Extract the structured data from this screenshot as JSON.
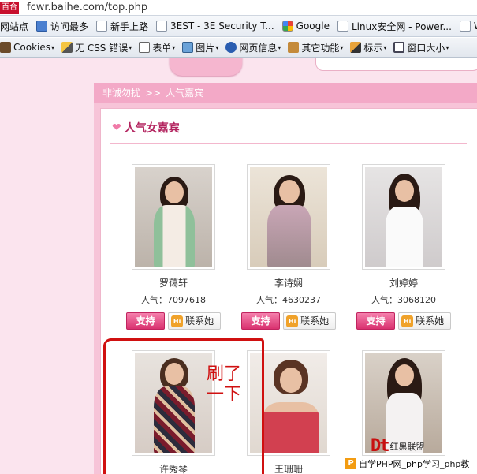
{
  "browser": {
    "site_tag": "百合",
    "url": "fcwr.baihe.com/top.php"
  },
  "bookmarks": [
    {
      "label": "网站点",
      "icon": "folder-icon"
    },
    {
      "label": "访问最多",
      "icon": "page-icon"
    },
    {
      "label": "新手上路",
      "icon": "page-icon"
    },
    {
      "label": "3EST - 3E Security T...",
      "icon": "page-icon"
    },
    {
      "label": "Google",
      "icon": "google-icon"
    },
    {
      "label": "Linux安全网 - Power...",
      "icon": "page-icon"
    },
    {
      "label": "W",
      "icon": "page-icon"
    }
  ],
  "toolbar": [
    {
      "label": "Cookies",
      "icon": "cookie-icon"
    },
    {
      "label": "无 CSS 错误",
      "icon": "pencil-icon"
    },
    {
      "label": "表单",
      "icon": "form-icon"
    },
    {
      "label": "图片",
      "icon": "image-icon"
    },
    {
      "label": "网页信息",
      "icon": "info-icon"
    },
    {
      "label": "其它功能",
      "icon": "toolbox-icon"
    },
    {
      "label": "标示",
      "icon": "marker-icon"
    },
    {
      "label": "窗口大小",
      "icon": "window-icon"
    }
  ],
  "breadcrumb": {
    "home": "非诚勿扰",
    "separator": ">>",
    "current": "人气嘉宾"
  },
  "panel": {
    "title": "人气女嘉宾"
  },
  "guests": [
    {
      "name": "罗蔼轩",
      "popularity": "人气：7097618",
      "support": "支持",
      "contact": "联系她"
    },
    {
      "name": "李诗娴",
      "popularity": "人气：4630237",
      "support": "支持",
      "contact": "联系她"
    },
    {
      "name": "刘婷婷",
      "popularity": "人气：3068120",
      "support": "支持",
      "contact": "联系她"
    },
    {
      "name": "许秀琴"
    },
    {
      "name": "王珊珊"
    },
    {
      "name": ""
    }
  ],
  "annotation": {
    "line1": "刷了",
    "line2": "一下"
  },
  "watermark": {
    "logo": "Dt",
    "sub": "红黑联盟",
    "footer": "自学PHP网_php学习_php教"
  },
  "colors": {
    "page_bg": "#fbe4ee",
    "accent": "#d9316f",
    "annotation": "#d01010"
  }
}
